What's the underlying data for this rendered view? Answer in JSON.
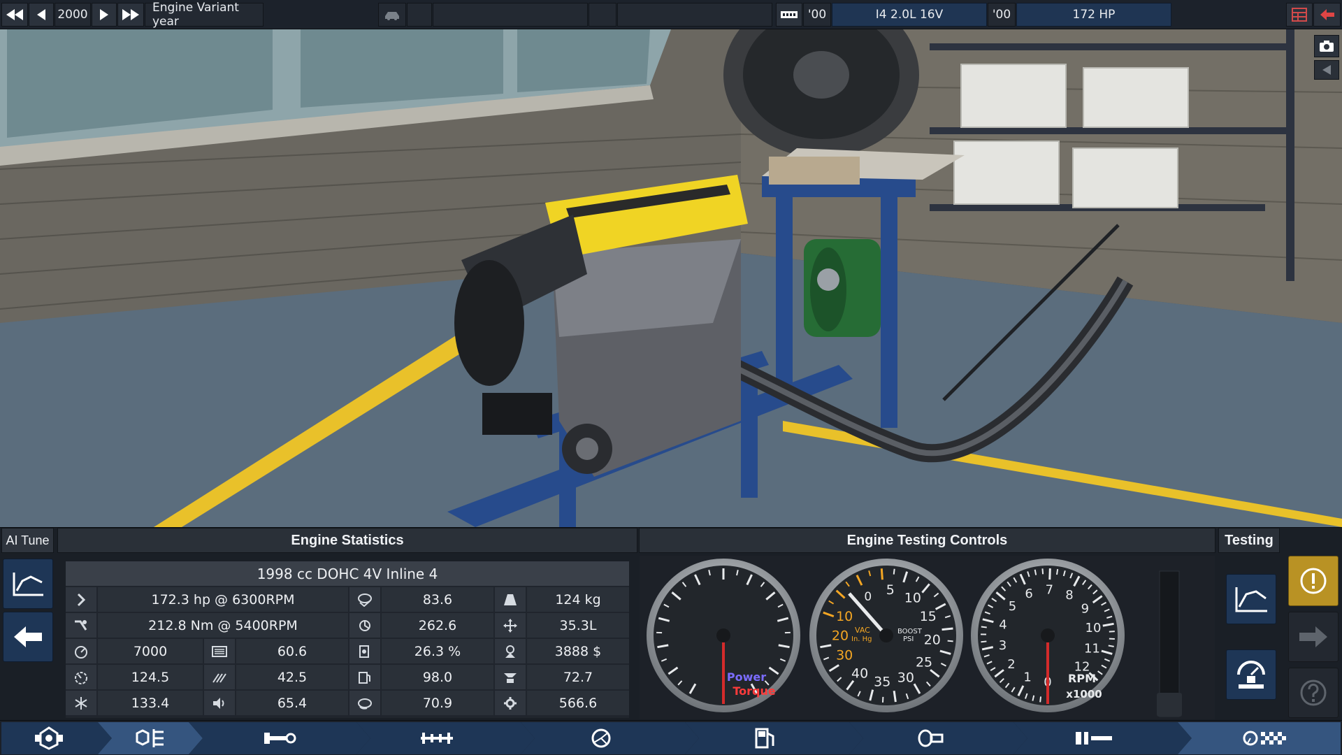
{
  "topbar": {
    "year": "2000",
    "year_label": "Engine Variant year",
    "variant_year": "'00",
    "variant_name": "I4 2.0L 16V",
    "variant_year_2": "'00",
    "power_display": "172 HP"
  },
  "ai_tune": {
    "label": "AI Tune"
  },
  "stats": {
    "header": "Engine Statistics",
    "title": "1998 cc DOHC 4V  Inline 4",
    "rows": [
      [
        "172.3 hp @ 6300RPM",
        "83.6",
        "124 kg"
      ],
      [
        "212.8 Nm @ 5400RPM",
        "262.6",
        "35.3L"
      ],
      [
        "7000",
        "60.6",
        "26.3 %",
        "3888 $"
      ],
      [
        "124.5",
        "42.5",
        "98.0",
        "72.7"
      ],
      [
        "133.4",
        "65.4",
        "70.9",
        "566.6"
      ]
    ]
  },
  "testing_controls": {
    "header": "Engine Testing Controls",
    "gauge1": {
      "label_power": "Power",
      "label_torque": "Torque"
    },
    "gauge2": {
      "ticks": [
        "5",
        "10",
        "15",
        "20",
        "25",
        "30",
        "35",
        "40"
      ],
      "vac_ticks": [
        "10",
        "20",
        "30"
      ],
      "vac_label": "VAC",
      "vac_unit": "In. Hg",
      "boost_label": "BOOST",
      "boost_unit": "PSI",
      "zero": "0"
    },
    "gauge3": {
      "ticks": [
        "0",
        "1",
        "2",
        "3",
        "4",
        "5",
        "6",
        "7",
        "8",
        "9",
        "10",
        "11",
        "12"
      ],
      "label": "RPM",
      "unit": "x1000"
    }
  },
  "testing": {
    "header": "Testing"
  },
  "colors": {
    "accent_blue": "#1e3656",
    "warning_gold": "#b99224",
    "power": "#7b6cff",
    "torque": "#ff3b3b",
    "vac_orange": "#f4a623"
  },
  "icons": {
    "top": [
      "rewind-icon",
      "step-back-icon",
      "play-icon",
      "fast-forward-icon",
      "car-icon",
      "gearbox-icon",
      "layout-icon",
      "back-arrow-icon",
      "camera-icon",
      "collapse-icon"
    ],
    "nav": [
      "factory-icon",
      "engine-family-icon",
      "crankshaft-icon",
      "camshaft-icon",
      "turbo-icon",
      "fuel-icon",
      "exhaust-icon",
      "cylinder-icon",
      "finish-icon"
    ]
  }
}
